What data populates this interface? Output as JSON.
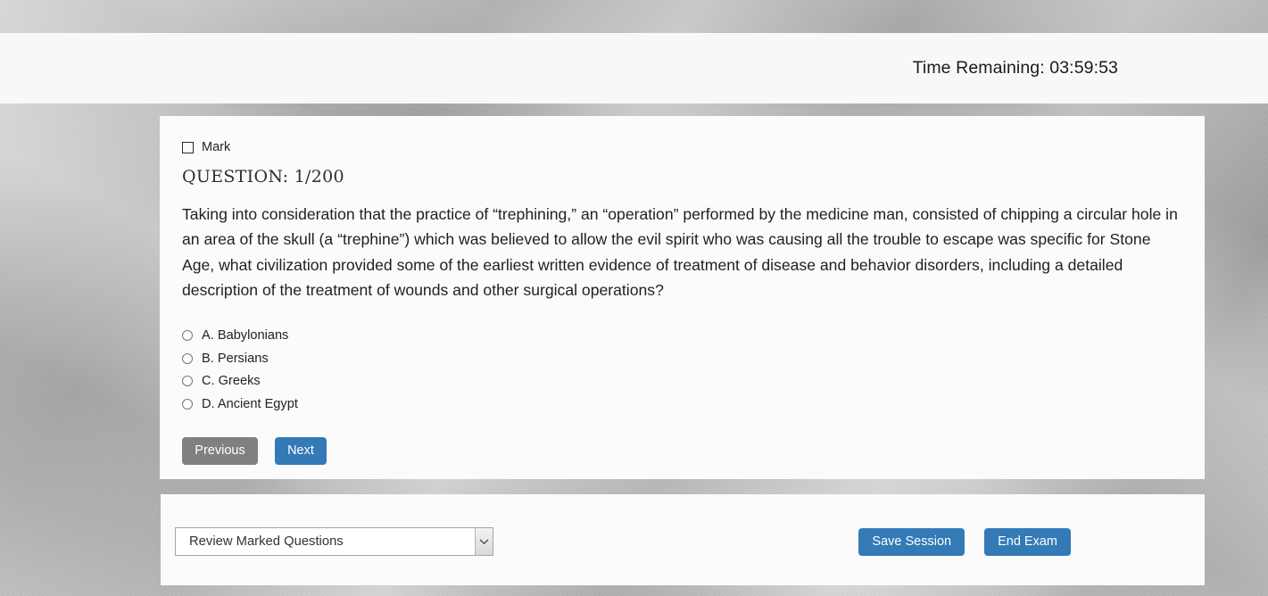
{
  "header": {
    "timer_label": "Time Remaining: 03:59:53"
  },
  "question_card": {
    "mark_label": "Mark",
    "question_number": "QUESTION: 1/200",
    "question_text": "Taking into consideration that the practice of “trephining,” an “operation” performed by the medicine man, consisted of chipping a circular hole in an area of the skull (a “trephine”) which was believed to allow the evil spirit who was causing all the trouble to escape was specific for Stone Age, what civilization provided some of the earliest written evidence of treatment of disease and behavior disorders, including a detailed description of the treatment of wounds and other surgical operations?",
    "options": [
      {
        "label": "A. Babylonians",
        "selected": false
      },
      {
        "label": "B. Persians",
        "selected": false
      },
      {
        "label": "C. Greeks",
        "selected": false
      },
      {
        "label": "D. Ancient Egypt",
        "selected": false
      }
    ],
    "previous_button": "Previous",
    "next_button": "Next"
  },
  "bottom_bar": {
    "review_select_value": "Review Marked Questions",
    "save_button": "Save Session",
    "end_button": "End Exam"
  },
  "colors": {
    "primary_blue": "#337ab7",
    "disabled_gray": "#808080",
    "card_background": "#fbfbfb",
    "header_background": "#f8f8f8"
  },
  "icons": {
    "mark_checkbox": "checkbox-unchecked-icon",
    "option_radio": "radio-unchecked-icon",
    "select_arrow": "chevron-down-icon"
  }
}
